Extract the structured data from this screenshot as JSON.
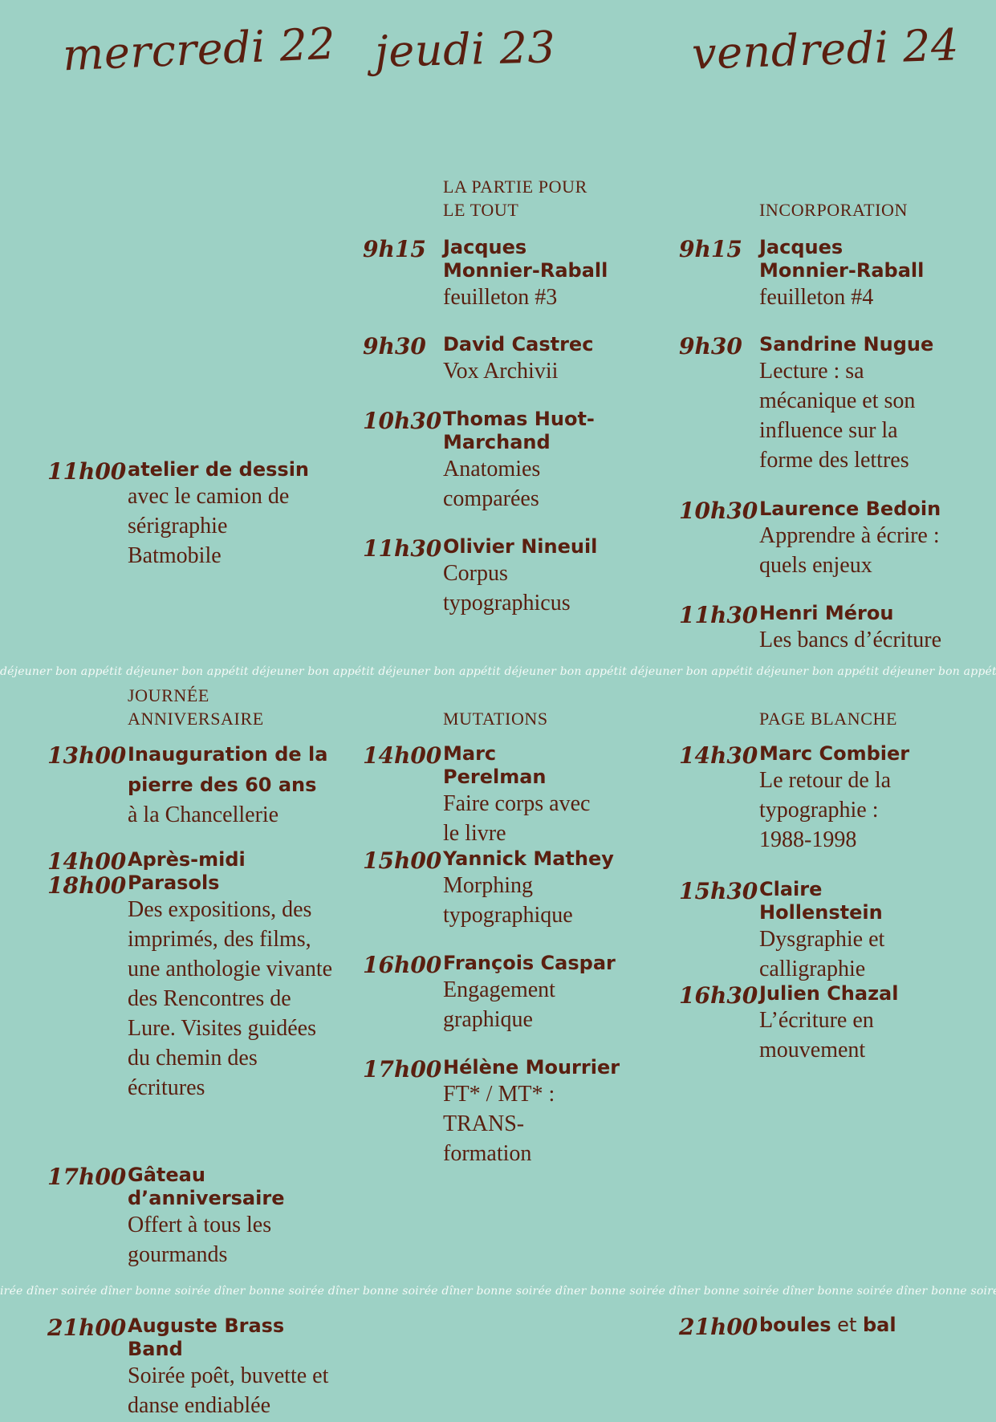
{
  "days": [
    "mercredi 22",
    "jeudi 23",
    "vendredi 24"
  ],
  "bands": {
    "lunch": "déjeuner bon appétit déjeuner bon appétit déjeuner bon appétit déjeuner bon appétit déjeuner bon appétit déjeuner bon appétit déjeuner bon appétit déjeuner bon appétit déjeuner",
    "dinner": "irée dîner soirée dîner bonne soirée dîner bonne soirée dîner bonne soirée dîner bonne soirée dîner bonne soirée dîner bonne soirée dîner bonne soirée dîner bonne soirée stop"
  },
  "sections": {
    "thu_morning": "LA PARTIE POUR LE TOUT",
    "fri_morning": "INCORPORATION",
    "wed_afternoon": "JOURNÉE ANNIVERSAIRE",
    "thu_afternoon": "MUTATIONS",
    "fri_afternoon": "PAGE BLANCHE"
  },
  "events": {
    "wed": [
      {
        "time": "11h00",
        "title": "atelier de dessin",
        "sub": "avec le camion de sérigraphie Batmobile"
      },
      {
        "time": "13h00",
        "title": "Inauguration de la pierre des 60 ans",
        "sub": "à la Chancellerie"
      },
      {
        "time": "14h00",
        "time2": "18h00",
        "title": "Après-midi Parasols",
        "sub": "Des expositions, des imprimés, des films, une anthologie vivante des Rencontres de Lure. Visites guidées du chemin des écritures"
      },
      {
        "time": "17h00",
        "title": "Gâteau d’anniversaire",
        "sub": "Offert à tous les gourmands"
      },
      {
        "time": "21h00",
        "title": "Auguste Brass Band",
        "sub": "Soirée poêt, buvette et danse endiablée"
      }
    ],
    "thu": [
      {
        "time": "9h15",
        "title": "Jacques Monnier-Raball",
        "sub": "feuilleton #3"
      },
      {
        "time": "9h30",
        "title": "David Castrec",
        "sub": "Vox Archivii"
      },
      {
        "time": "10h30",
        "title": "Thomas Huot-Marchand",
        "sub": "Anatomies comparées"
      },
      {
        "time": "11h30",
        "title": "Olivier Nineuil",
        "sub": "Corpus typographicus"
      },
      {
        "time": "14h00",
        "title": "Marc Perelman",
        "sub": "Faire corps avec le livre"
      },
      {
        "time": "15h00",
        "title": "Yannick Mathey",
        "sub": "Morphing typographique"
      },
      {
        "time": "16h00",
        "title": "François Caspar",
        "sub": "Engagement graphique"
      },
      {
        "time": "17h00",
        "title": "Hélène Mourrier",
        "sub": "FT* / MT* : TRANS-formation"
      }
    ],
    "fri": [
      {
        "time": "9h15",
        "title": "Jacques Monnier-Raball",
        "sub": "feuilleton #4"
      },
      {
        "time": "9h30",
        "title": "Sandrine Nugue",
        "sub": "Lecture : sa mécanique et son influence sur la forme des lettres"
      },
      {
        "time": "10h30",
        "title": "Laurence Bedoin",
        "sub": "Apprendre à écrire : quels enjeux"
      },
      {
        "time": "11h30",
        "title": "Henri Mérou",
        "sub": "Les bancs d’écriture"
      },
      {
        "time": "14h30",
        "title": "Marc Combier",
        "sub": "Le retour de la typographie : 1988-1998"
      },
      {
        "time": "15h30",
        "title": "Claire Hollenstein",
        "sub": "Dysgraphie et calligraphie"
      },
      {
        "time": "16h30",
        "title": "Julien Chazal",
        "sub": "L’écriture en mouvement"
      },
      {
        "time": "21h00",
        "title": "boules",
        "title_mid": " et ",
        "title_end": "bal"
      }
    ]
  }
}
